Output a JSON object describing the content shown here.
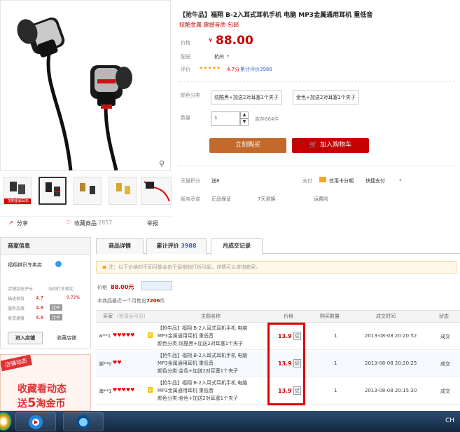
{
  "product": {
    "title": "【抢牛品】福翔 B-2入耳式耳机手机 电脑 MP3金属通用耳机 重低音",
    "subtitle": "炫酷金属 震撼音质 包邮",
    "price_label": "价格",
    "currency": "¥",
    "price": "88.00",
    "delivery_label": "配送",
    "delivery_value": "杭州",
    "rating_label": "评价",
    "rating_stars": "★★★★★",
    "rating_text": "4.7分",
    "rating_link": "累计评价3988",
    "color_label": "颜色分类",
    "options": [
      "炫酷黑+加送2对耳塞1个夹子",
      "金色+加送2对耳塞1个夹子"
    ],
    "qty_label": "数量",
    "qty_value": "1",
    "stock_text": "库存664件",
    "buy_label": "立刻购买",
    "cart_label": "加入购物车",
    "promise_label": "天猫积分",
    "promise_value": "送8",
    "payment_label": "支付",
    "credit_label": "信用卡分期",
    "express_label": "快捷支付",
    "service_label": "服务承诺",
    "service_items": [
      "正品保证",
      "7天退换",
      "运费险"
    ],
    "share_label": "分享",
    "fav_label": "收藏商品",
    "fav_count": "2857",
    "report_label": "举报",
    "zoom_icon": "magnifier-icon",
    "badge_text": "加购金属耳机"
  },
  "shop": {
    "header": "商家信息",
    "name": "福翔祺讯专卖店",
    "rating_header": "店铺动态评分",
    "compare_header": "与同行业相比",
    "metrics": [
      {
        "label": "描述相符",
        "value": "4.7",
        "compare": "0.72%"
      },
      {
        "label": "服务态度",
        "value": "4.8",
        "compare": "持平"
      },
      {
        "label": "发货速度",
        "value": "4.8",
        "compare": "持平"
      }
    ],
    "enter_btn": "进入店铺",
    "fav_btn": "收藏店铺",
    "banner_tag": "店铺动态",
    "banner_line1": "收藏看动态",
    "banner_line2_a": "送",
    "banner_line2_b": "5",
    "banner_line2_c": "淘金币"
  },
  "tabs": [
    {
      "label": "商品详情"
    },
    {
      "label": "累计评价",
      "count": "3988"
    },
    {
      "label": "月成交记录"
    }
  ],
  "records": {
    "notice": "注：以下价格的不同可能会由于促销和打折引起，详情可以咨询商家。",
    "price_prefix": "价格",
    "price_value": "88.00元",
    "total_prefix": "本商品最近一个月售出",
    "total_count": "7206",
    "total_unit": "件",
    "columns": {
      "buyer": "买家",
      "buyer_note": "(登录后可见)",
      "title": "主题名称",
      "price": "价格",
      "qty": "购买数量",
      "time": "成交时间",
      "status": "状态"
    },
    "rows": [
      {
        "buyer": "w**1",
        "title_l1": "【抢牛品】福翔 B-2入耳式耳机手机 电脑",
        "title_l2": "MP3金属通用耳机 重低音",
        "title_l3": "颜色分类:炫酷黑+加送2对耳塞1个夹子",
        "price": "13.9",
        "qty": "1",
        "time": "2013-08-08 20:20:52",
        "status": "成交"
      },
      {
        "buyer": "谢**0",
        "title_l1": "【抢牛品】福翔 B-2入耳式耳机手机 电脑",
        "title_l2": "MP3金属通用耳机 重低音",
        "title_l3": "颜色分类:金色+加送2对耳塞1个夹子",
        "price": "13.9",
        "qty": "1",
        "time": "2013-08-08 20:20:25",
        "status": "成交"
      },
      {
        "buyer": "海**1",
        "title_l1": "【抢牛品】福翔 B-2入耳式耳机手机 电脑",
        "title_l2": "MP3金属通用耳机 重低音",
        "title_l3": "颜色分类:金色+加送2对耳塞1个夹子",
        "price": "13.9",
        "qty": "1",
        "time": "2013-08-08 20:15:30",
        "status": "成交"
      }
    ]
  },
  "taskbar": {
    "lang": "CH"
  }
}
